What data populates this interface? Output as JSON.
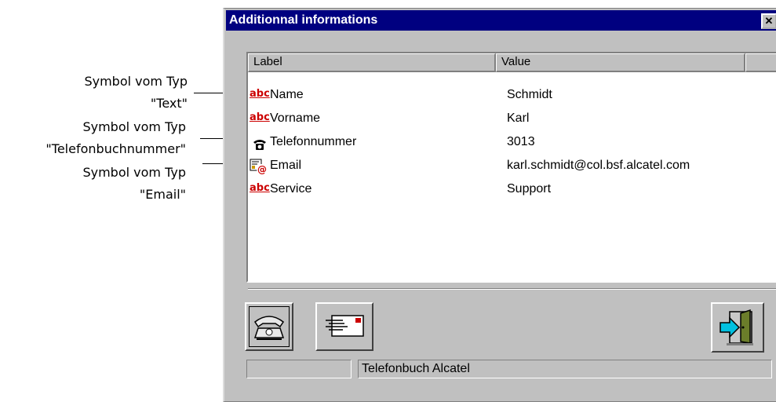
{
  "annotations": [
    {
      "line1": "Symbol vom Typ",
      "line2": "\"Text\""
    },
    {
      "line1": "Symbol vom Typ",
      "line2": "\"Telefonbuchnummer\""
    },
    {
      "line1": "Symbol vom Typ",
      "line2": "\"Email\""
    }
  ],
  "dialog": {
    "title": "Additionnal informations",
    "close_glyph": "✕"
  },
  "table": {
    "columns": [
      "Label",
      "Value"
    ],
    "rows": [
      {
        "icon": "text-icon",
        "icon_text": "abc",
        "label": "Name",
        "value": "Schmidt"
      },
      {
        "icon": "text-icon",
        "icon_text": "abc",
        "label": "Vorname",
        "value": "Karl"
      },
      {
        "icon": "phone-icon",
        "label": "Telefonnummer",
        "value": "3013"
      },
      {
        "icon": "email-icon",
        "label": "Email",
        "value": "karl.schmidt@col.bsf.alcatel.com"
      },
      {
        "icon": "text-icon",
        "icon_text": "abc",
        "label": "Service",
        "value": "Support"
      }
    ]
  },
  "toolbar": {
    "buttons": [
      {
        "icon": "telephone-icon"
      },
      {
        "icon": "envelope-icon"
      },
      {
        "icon": "exit-door-icon"
      }
    ]
  },
  "status": {
    "left": "",
    "right": "Telefonbuch Alcatel"
  },
  "colors": {
    "title_bar": "#000080",
    "window_bg": "#c0c0c0",
    "abc_red": "#cc0000"
  }
}
